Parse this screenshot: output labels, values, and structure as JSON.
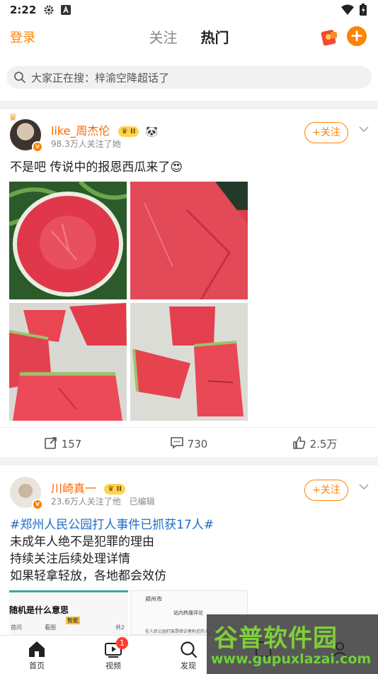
{
  "status_bar": {
    "time": "2:22"
  },
  "header": {
    "login": "登录",
    "tabs": [
      "关注",
      "热门"
    ],
    "active_tab": 1
  },
  "search": {
    "placeholder": "大家正在搜：梓渝空降超话了"
  },
  "posts": [
    {
      "author": "like_周杰伦",
      "vip_level": "II",
      "followers": "98.3万人关注了她",
      "follow_label": "+关注",
      "text": "不是吧 传说中的报恩西瓜来了",
      "emoji": "😍",
      "reposts": "157",
      "comments": "730",
      "likes": "2.5万"
    },
    {
      "author": "川崎真一",
      "vip_level": "II",
      "followers": "23.6万人关注了他",
      "edited": "已编辑",
      "follow_label": "+关注",
      "hashtag": "#郑州人民公园打人事件已抓获17人#",
      "lines": [
        "未成年人绝不是犯罪的理由",
        "持续关注后续处理详情",
        "如果轻拿轻放，各地都会效仿"
      ],
      "thumb1_title": "随机是什么意思",
      "thumb1_tag": "智能",
      "thumb1_sub": "首问",
      "thumb1_sub2": "看图",
      "thumb1_right": "共2",
      "thumb2_title": "郑州市",
      "thumb2_sub": "站内热搜评论",
      "thumb2_text": "在人民公园打架是暗访者附近的人"
    }
  ],
  "bottom_nav": [
    {
      "label": "首页"
    },
    {
      "label": "视频",
      "badge": "1"
    },
    {
      "label": "发现"
    },
    {
      "label": ""
    },
    {
      "label": ""
    }
  ],
  "watermark": {
    "title": "谷普软件园",
    "url": "www.gupuxlazai.com"
  },
  "colors": {
    "accent": "#ff8200",
    "link": "#1e6cc4"
  }
}
